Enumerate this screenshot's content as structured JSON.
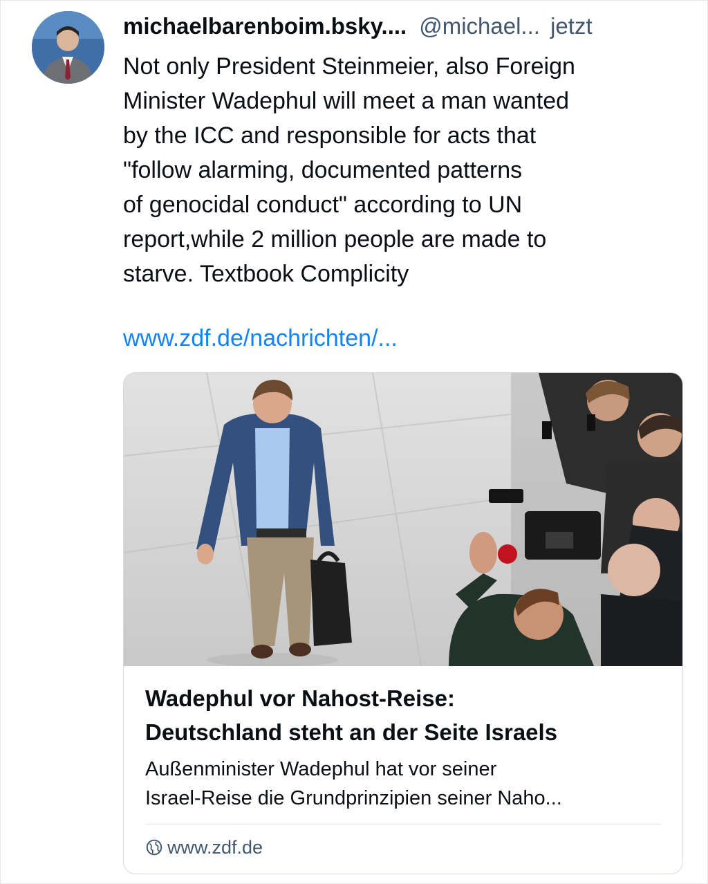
{
  "post": {
    "display_name": "michaelbarenboim.bsky....",
    "handle": "@michael...",
    "time": "jetzt",
    "text_lines": [
      "Not only President Steinmeier, also Foreign",
      "Minister Wadephul will meet a man wanted",
      "by the ICC and responsible for acts that",
      "\"follow alarming, documented patterns",
      "of genocidal conduct\" according to UN",
      "report,while 2 million people are made to",
      "starve. Textbook Complicity"
    ],
    "link": "www.zdf.de/nachrichten/..."
  },
  "card": {
    "title_lines": [
      "Wadephul vor Nahost-Reise:",
      "Deutschland steht an der Seite Israels"
    ],
    "description_lines": [
      "Außenminister Wadephul hat vor seiner",
      "Israel-Reise die Grundprinzipien seiner Naho..."
    ],
    "domain": "www.zdf.de"
  },
  "icons": {
    "avatar": "user-avatar-photo",
    "domain": "globe-icon"
  },
  "colors": {
    "link": "#1083fe",
    "secondary_text": "#42576c",
    "border": "#d4dbe2"
  }
}
